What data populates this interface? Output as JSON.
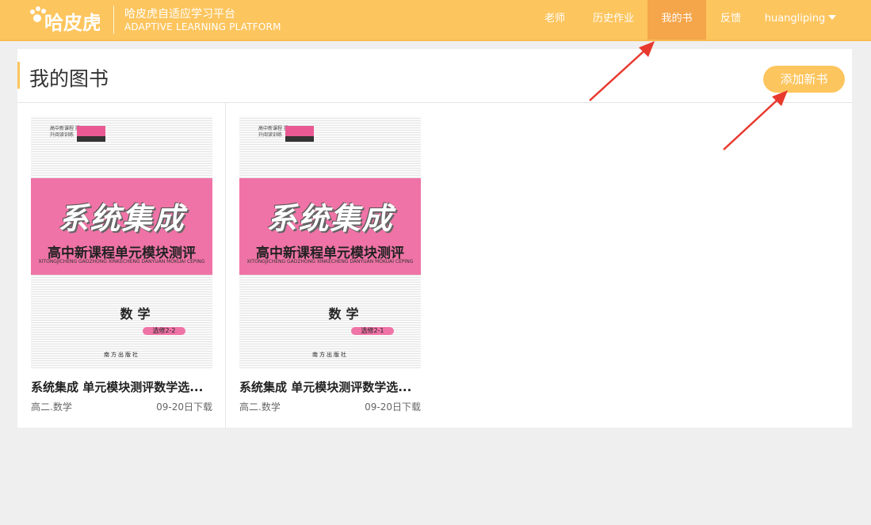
{
  "header": {
    "brand_cn": "哈皮虎自适应学习平台",
    "brand_en": "ADAPTIVE LEARNING PLATFORM",
    "logo_text": "哈皮虎",
    "nav": {
      "teacher": "老师",
      "history": "历史作业",
      "mybooks": "我的书",
      "feedback": "反馈",
      "user": "huangliping"
    },
    "colors": {
      "bar": "#fdc55e",
      "active": "#f5a54a"
    }
  },
  "main": {
    "title": "我的图书",
    "add_button": "添加新书"
  },
  "books": [
    {
      "name": "系统集成 单元模块测评数学选...",
      "meta": "高二.数学",
      "date": "09-20日下载",
      "cover": {
        "series": "高中新课程 提升阅读训练",
        "big": "系统集成",
        "sub": "高中新课程单元模块测评",
        "pinyin": "XITONGJICHENG GAOZHONG XINKECHENG DANYUAN MOKUAI CEPING",
        "subject": "数学",
        "volume": "选修2-2",
        "publisher": "南方出版社"
      }
    },
    {
      "name": "系统集成 单元模块测评数学选...",
      "meta": "高二.数学",
      "date": "09-20日下载",
      "cover": {
        "series": "高中新课程 提升阅读训练",
        "big": "系统集成",
        "sub": "高中新课程单元模块测评",
        "pinyin": "XITONGJICHENG GAOZHONG XINKECHENG DANYUAN MOKUAI CEPING",
        "subject": "数学",
        "volume": "选修2-1",
        "publisher": "南方出版社"
      }
    }
  ],
  "annotations": {
    "arrow_color": "#e8392f"
  }
}
